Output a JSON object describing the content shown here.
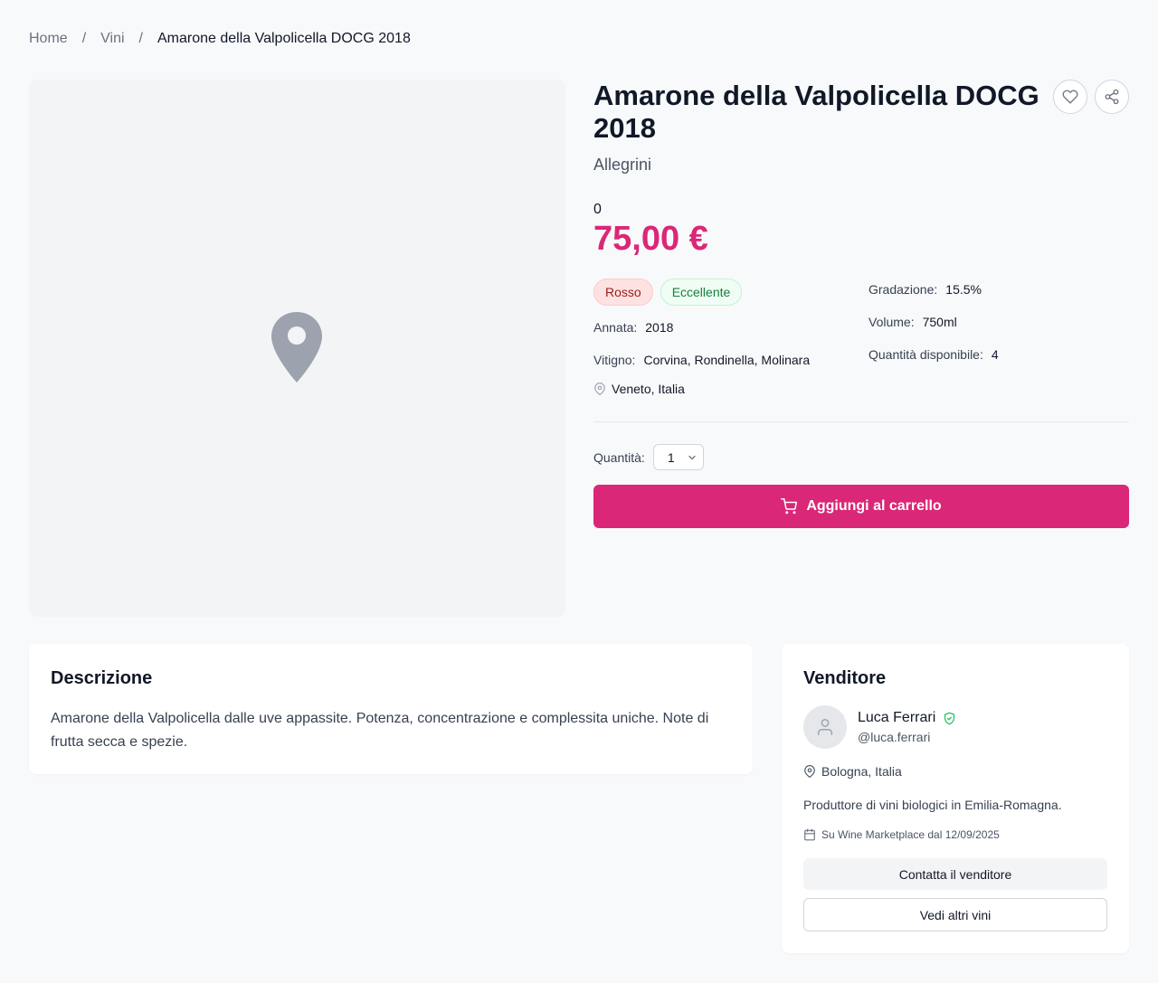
{
  "breadcrumb": {
    "home": "Home",
    "category": "Vini",
    "current": "Amarone della Valpolicella DOCG 2018",
    "separator": "/"
  },
  "product": {
    "title": "Amarone della Valpolicella DOCG 2018",
    "producer": "Allegrini",
    "zero_text": "0",
    "price": "75,00 €",
    "badges": [
      "Rosso",
      "Eccellente"
    ],
    "vintage_label": "Annata:",
    "vintage_value": "2018",
    "grape_label": "Vitigno:",
    "grape_value": "Corvina, Rondinella, Molinara",
    "region": "Veneto, Italia",
    "abv_label": "Gradazione:",
    "abv_value": "15.5%",
    "volume_label": "Volume:",
    "volume_value": "750ml",
    "stock_label": "Quantità disponibile:",
    "stock_value": "4",
    "qty_label": "Quantità:",
    "qty_selected": "1",
    "add_to_cart": "Aggiungi al carrello"
  },
  "description": {
    "heading": "Descrizione",
    "text": "Amarone della Valpolicella dalle uve appassite. Potenza, concentrazione e complessita uniche. Note di frutta secca e spezie."
  },
  "seller": {
    "heading": "Venditore",
    "name": "Luca Ferrari",
    "handle": "@luca.ferrari",
    "location": "Bologna, Italia",
    "bio": "Produttore di vini biologici in Emilia-Romagna.",
    "since": "Su Wine Marketplace dal 12/09/2025",
    "contact_button": "Contatta il venditore",
    "more_button": "Vedi altri vini"
  },
  "colors": {
    "accent": "#db2777",
    "badge_red_bg": "#fee2e2",
    "badge_green_bg": "#f0fdf4",
    "verified": "#22c55e"
  },
  "icons": [
    "heart-icon",
    "share-icon",
    "map-pin-icon",
    "cart-icon",
    "user-icon",
    "verified-icon",
    "calendar-icon",
    "chevron-down-icon"
  ]
}
